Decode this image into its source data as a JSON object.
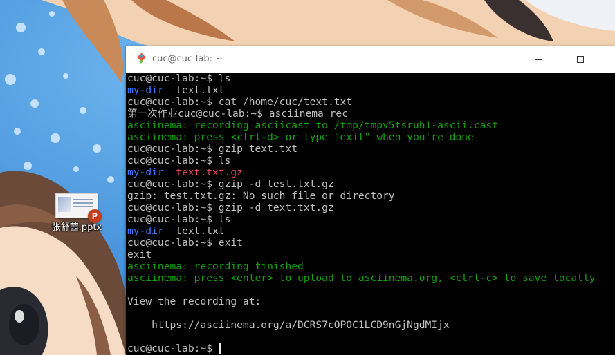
{
  "desktop": {
    "icon_label": "张舒茜.pptx",
    "icon_badge": "P"
  },
  "window": {
    "title": "cuc@cuc-lab: ~"
  },
  "colors": {
    "prompt": "#c0c0c0",
    "asciinema_message": "#13a10e",
    "directory": "#3b78ff",
    "archive": "#e74856",
    "background": "#000000"
  },
  "terminal": {
    "lines": [
      [
        {
          "t": "cuc@cuc-lab:~$ ls",
          "c": "white"
        }
      ],
      [
        {
          "t": "my-dir",
          "c": "blue"
        },
        {
          "t": "  text.txt",
          "c": "white"
        }
      ],
      [
        {
          "t": "cuc@cuc-lab:~$ cat /home/cuc/text.txt",
          "c": "white"
        }
      ],
      [
        {
          "t": "第一次作业cuc@cuc-lab:~$ asciinema rec",
          "c": "white"
        }
      ],
      [
        {
          "t": "asciinema: recording asciicast to /tmp/tmpv5tsruh1-ascii.cast",
          "c": "green"
        }
      ],
      [
        {
          "t": "asciinema: press <ctrl-d> or type \"exit\" when you're done",
          "c": "green"
        }
      ],
      [
        {
          "t": "cuc@cuc-lab:~$ gzip text.txt",
          "c": "white"
        }
      ],
      [
        {
          "t": "cuc@cuc-lab:~$ ls",
          "c": "white"
        }
      ],
      [
        {
          "t": "my-dir",
          "c": "blue"
        },
        {
          "t": "  ",
          "c": "white"
        },
        {
          "t": "text.txt.gz",
          "c": "red"
        }
      ],
      [
        {
          "t": "cuc@cuc-lab:~$ gzip -d test.txt.gz",
          "c": "white"
        }
      ],
      [
        {
          "t": "gzip: test.txt.gz: No such file or directory",
          "c": "white"
        }
      ],
      [
        {
          "t": "cuc@cuc-lab:~$ gzip -d text.txt.gz",
          "c": "white"
        }
      ],
      [
        {
          "t": "cuc@cuc-lab:~$ ls",
          "c": "white"
        }
      ],
      [
        {
          "t": "my-dir",
          "c": "blue"
        },
        {
          "t": "  text.txt",
          "c": "white"
        }
      ],
      [
        {
          "t": "cuc@cuc-lab:~$ exit",
          "c": "white"
        }
      ],
      [
        {
          "t": "exit",
          "c": "white"
        }
      ],
      [
        {
          "t": "asciinema: recording finished",
          "c": "green"
        }
      ],
      [
        {
          "t": "asciinema: press <enter> to upload to asciinema.org, <ctrl-c> to save locally",
          "c": "green"
        }
      ],
      [],
      [
        {
          "t": "View the recording at:",
          "c": "white"
        }
      ],
      [],
      [
        {
          "t": "    https://asciinema.org/a/DCRS7cOPOC1LCD9nGjNgdMIjx",
          "c": "white"
        }
      ],
      [],
      [
        {
          "t": "cuc@cuc-lab:~$ ",
          "c": "white",
          "cursor": true
        }
      ]
    ]
  }
}
